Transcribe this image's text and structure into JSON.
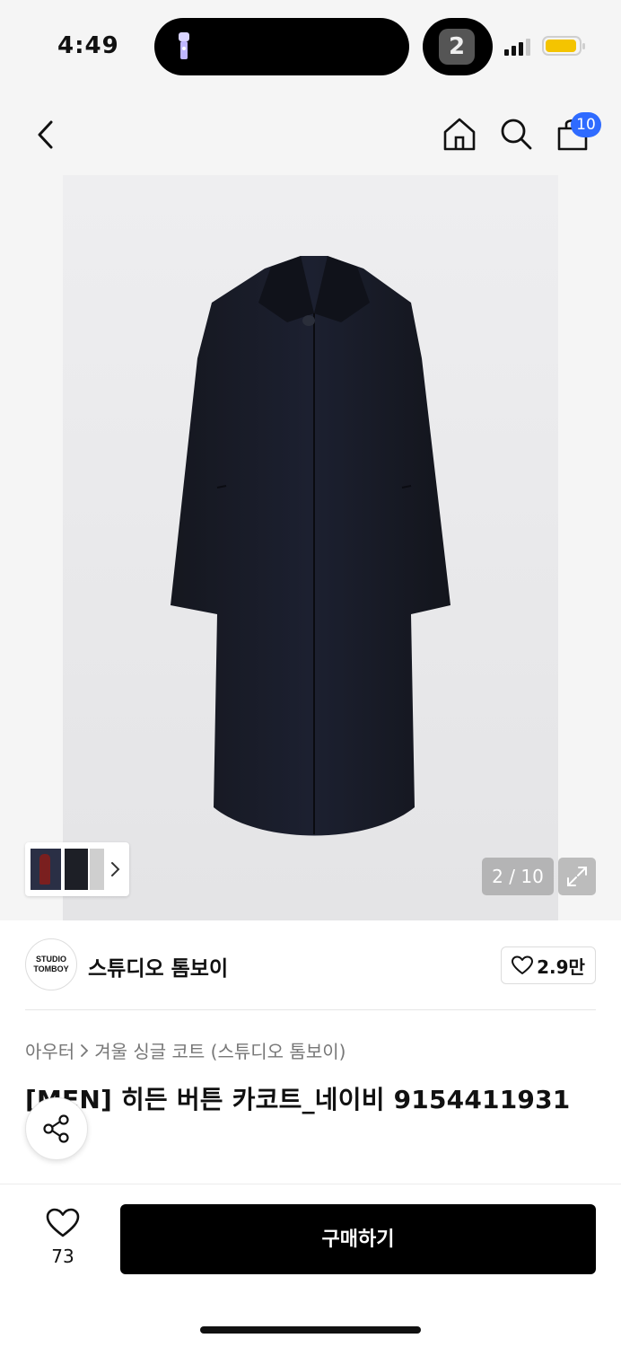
{
  "status_bar": {
    "time": "4:49",
    "app_badge": "2",
    "battery_color": "#f4c400"
  },
  "header": {
    "back_icon": "chevron-left-icon",
    "home_icon": "home-icon",
    "search_icon": "search-icon",
    "cart_icon": "shopping-bag-icon",
    "cart_badge": "10",
    "badge_color": "#2f6bff"
  },
  "gallery": {
    "counter": "2 / 10",
    "expand_icon": "expand-icon",
    "current_index": 2,
    "total": 10
  },
  "brand": {
    "logo_line1": "STUDIO",
    "logo_line2": "TOMBOY",
    "name": "스튜디오 톰보이",
    "like_count": "2.9만"
  },
  "product": {
    "breadcrumb": [
      "아우터",
      "겨울 싱글 코트 (스튜디오 톰보이)"
    ],
    "title": "[MEN] 히든 버튼 카코트_네이비 9154411931"
  },
  "bottom_bar": {
    "wish_count": "73",
    "buy_label": "구매하기"
  }
}
